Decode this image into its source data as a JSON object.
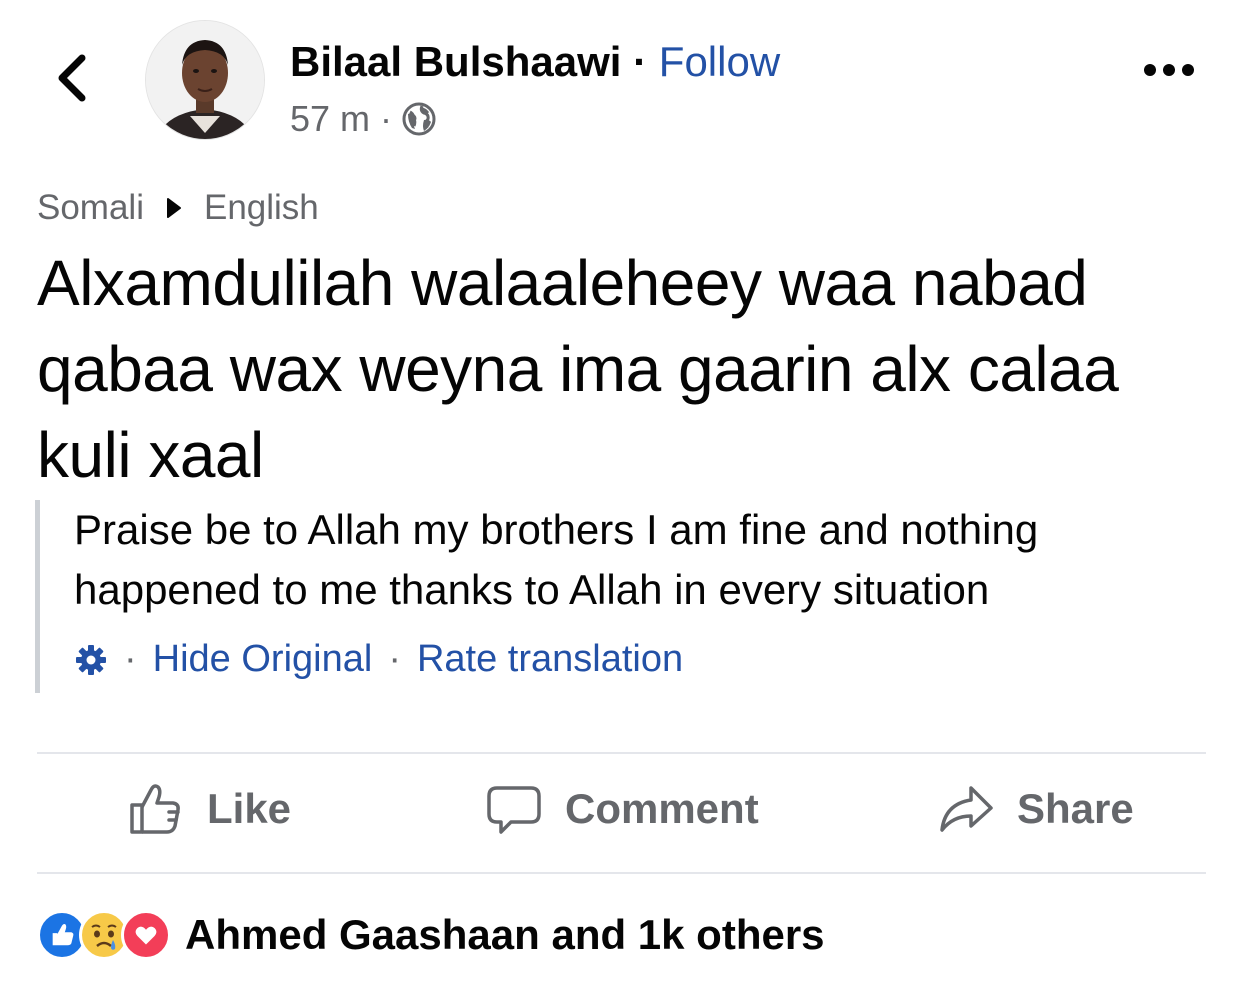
{
  "header": {
    "author_name": "Bilaal Bulshaawi",
    "separator": "·",
    "follow_label": "Follow",
    "time": "57 m",
    "meta_separator": "·",
    "privacy_icon": "globe-icon",
    "more_icon": "more-options-icon",
    "back_icon": "chevron-left-icon"
  },
  "translation_bar": {
    "source_language": "Somali",
    "target_language": "English"
  },
  "post": {
    "original_text": "Alxamdulilah walaaleheey waa nabad qabaa wax weyna ima gaarin alx calaa kuli xaal",
    "translated_text": "Praise be to Allah my brothers I am fine and nothing happened to me thanks to Allah in every situation"
  },
  "translation_tools": {
    "settings_icon": "gear-icon",
    "sep1": "·",
    "hide_original": "Hide Original",
    "sep2": "·",
    "rate_translation": "Rate translation"
  },
  "actions": {
    "like": "Like",
    "comment": "Comment",
    "share": "Share"
  },
  "reactions": {
    "summary": "Ahmed Gaashaan and 1k others",
    "types": [
      "like",
      "sad",
      "love"
    ]
  },
  "colors": {
    "link_blue": "#2351a6",
    "secondary_text": "#65676b",
    "like_blue": "#1b74e4",
    "love_red": "#f33e58",
    "sad_yellow": "#f7c948"
  }
}
